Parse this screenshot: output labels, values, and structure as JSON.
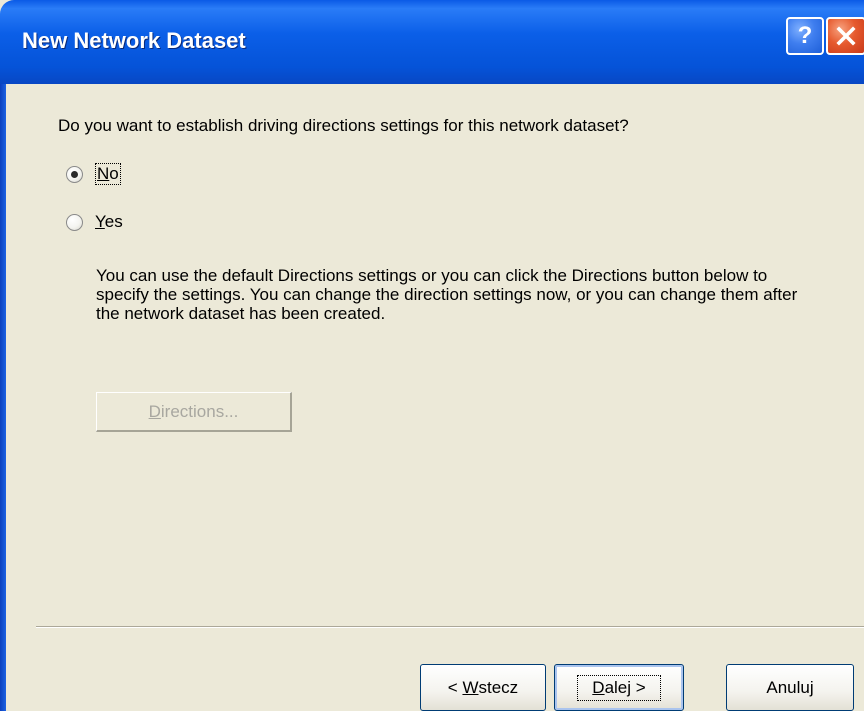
{
  "window": {
    "title": "New Network Dataset",
    "help_glyph": "?",
    "icons": {
      "help": "help-icon",
      "close": "close-icon"
    }
  },
  "question": "Do you want to establish driving directions settings for this network dataset?",
  "options": {
    "no": {
      "label_underlined": "N",
      "label_rest": "o",
      "selected": true
    },
    "yes": {
      "label_underlined": "Y",
      "label_rest": "es",
      "selected": false
    }
  },
  "info_text": "You can use the default Directions settings or you can click the Directions button below to specify the settings. You can change the direction settings now, or you can change them after the network dataset has been created.",
  "directions_button": {
    "label_underlined": "D",
    "label_rest": "irections...",
    "enabled": false
  },
  "footer": {
    "back": {
      "prefix": "< ",
      "underlined": "W",
      "rest": "stecz"
    },
    "next": {
      "underlined": "D",
      "rest": "alej >"
    },
    "cancel": {
      "label": "Anuluj"
    }
  },
  "colors": {
    "titlebar": "#0553d8",
    "dialog_background": "#ece9d8",
    "close_button": "#e65a2e",
    "disabled_text": "#a8a7a0"
  }
}
